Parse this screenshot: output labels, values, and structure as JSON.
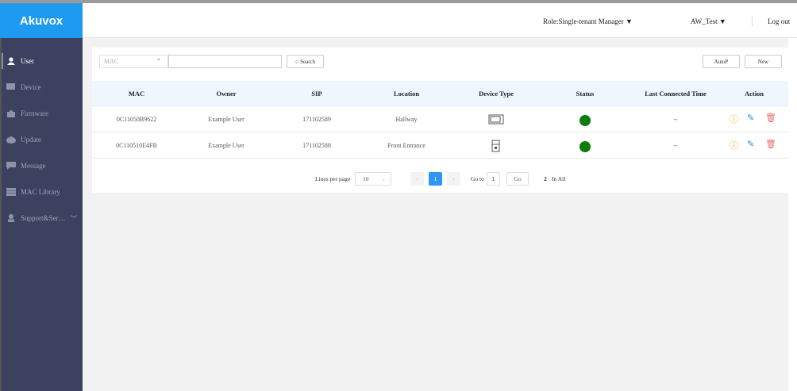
{
  "brand": {
    "logo": "Akuvox",
    "color": "#1e9bf0"
  },
  "header": {
    "role": "Role:Single-tenant Manager ▼",
    "user": "AW_Test ▼",
    "logout": "Log out"
  },
  "sidebar": {
    "items": [
      {
        "label": "User",
        "icon": "user-icon",
        "active": true
      },
      {
        "label": "Device",
        "icon": "device-icon"
      },
      {
        "label": "Firmware",
        "icon": "puzzle-icon"
      },
      {
        "label": "Update",
        "icon": "cloud-upload-icon"
      },
      {
        "label": "Message",
        "icon": "message-icon"
      },
      {
        "label": "MAC Library",
        "icon": "library-icon"
      },
      {
        "label": "Support&Ser…",
        "icon": "support-icon"
      }
    ]
  },
  "search": {
    "field": "MAC",
    "value": "",
    "button": "Search"
  },
  "toolbar": {
    "autop": "AutoP",
    "new": "New"
  },
  "table": {
    "columns": [
      "MAC",
      "Owner",
      "SIP",
      "Location",
      "Device Type",
      "Status",
      "Last Connected Time",
      "Action"
    ],
    "rows": [
      {
        "mac": "0C11050B9622",
        "owner": "Example User",
        "sip": "171102589",
        "location": "Hallway",
        "device_type": "indoor-monitor",
        "status": "online",
        "last": "--"
      },
      {
        "mac": "0C110510E4FB",
        "owner": "Example User",
        "sip": "171102588",
        "location": "Front Entrance",
        "device_type": "door-phone",
        "status": "online",
        "last": "--"
      }
    ]
  },
  "pagination": {
    "lines_label": "Lines per page",
    "lines": "10",
    "current": "1",
    "goto_label": "Go to",
    "goto_value": "1",
    "go": "Go",
    "total": "2",
    "total_label": "In All"
  }
}
